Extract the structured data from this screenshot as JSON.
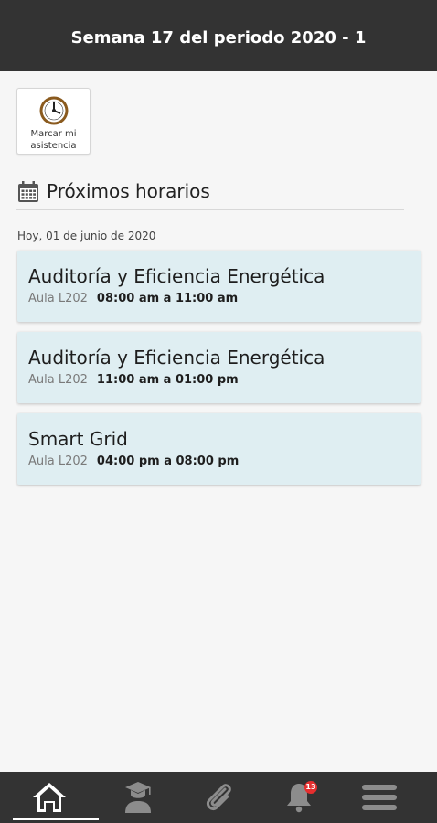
{
  "header": {
    "title": "Semana 17 del periodo 2020 - 1"
  },
  "attendance_button": {
    "label": "Marcar mi asistencia",
    "icon": "clock-icon"
  },
  "section": {
    "title": "Próximos horarios",
    "icon": "calendar-icon"
  },
  "date_label": "Hoy, 01 de junio de 2020",
  "schedule": [
    {
      "course": "Auditoría y Eficiencia Energética",
      "room": "Aula L202",
      "time": "08:00 am a 11:00 am"
    },
    {
      "course": "Auditoría y Eficiencia Energética",
      "room": "Aula L202",
      "time": "11:00 am a 01:00 pm"
    },
    {
      "course": "Smart Grid",
      "room": "Aula L202",
      "time": "04:00 pm a 08:00 pm"
    }
  ],
  "bottom_nav": {
    "items": [
      {
        "icon": "home-icon",
        "active": true
      },
      {
        "icon": "graduate-icon",
        "active": false
      },
      {
        "icon": "paperclip-icon",
        "active": false
      },
      {
        "icon": "bell-icon",
        "active": false,
        "badge": "13"
      },
      {
        "icon": "menu-icon",
        "active": false
      }
    ]
  },
  "colors": {
    "bar": "#333333",
    "card": "#dfeef2",
    "badge": "#e52e2e",
    "background": "#f6f6f6"
  }
}
